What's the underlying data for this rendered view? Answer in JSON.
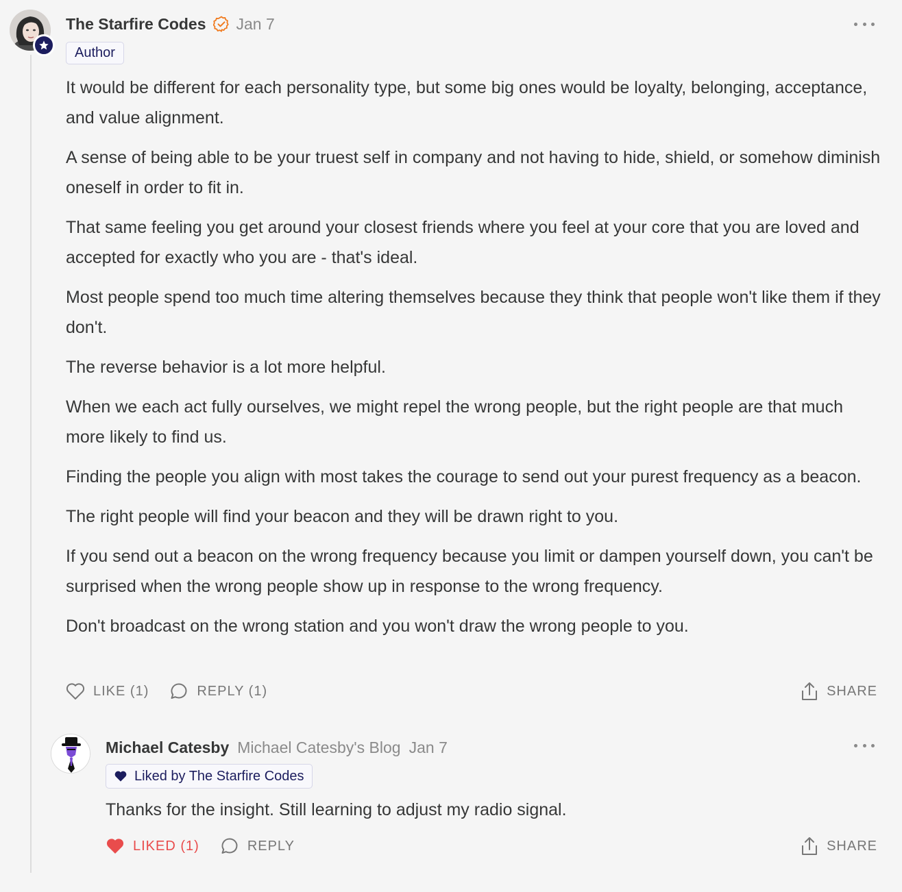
{
  "comment": {
    "author": "The Starfire Codes",
    "date": "Jan 7",
    "badge": "Author",
    "paragraphs": [
      "It would be different for each personality type, but some big ones would be loyalty, belonging, acceptance, and value alignment.",
      "A sense of being able to be your truest self in company and not having to hide, shield, or somehow diminish oneself in order to fit in.",
      "That same feeling you get around your closest friends where you feel at your core that you are loved and accepted for exactly who you are - that's ideal.",
      "Most people spend too much time altering themselves because they think that people won't like them if they don't.",
      "The reverse behavior is a lot more helpful.",
      "When we each act fully ourselves, we might repel the wrong people, but the right people are that much more likely to find us.",
      "Finding the people you align with most takes the courage to send out your purest frequency as a beacon.",
      "The right people will find your beacon and they will be drawn right to you.",
      "If you send out a beacon on the wrong frequency because you limit or dampen yourself down, you can't be surprised when the wrong people show up in response to the wrong frequency.",
      "Don't broadcast on the wrong station and you won't draw the wrong people to you."
    ],
    "like_label": "LIKE (1)",
    "reply_label": "REPLY (1)",
    "share_label": "SHARE"
  },
  "reply": {
    "author": "Michael Catesby",
    "blog": "Michael Catesby's Blog",
    "date": "Jan 7",
    "liked_by": "Liked by The Starfire Codes",
    "text": "Thanks for the insight. Still learning to adjust my radio signal.",
    "liked_label": "LIKED (1)",
    "reply_label": "REPLY",
    "share_label": "SHARE"
  },
  "colors": {
    "accent_navy": "#1c1d5e",
    "verified_orange": "#f07a1e",
    "liked_red": "#e94c4c",
    "muted_text": "#777777"
  },
  "icons": [
    "verified-check-icon",
    "star-badge-icon",
    "more-options-icon",
    "heart-outline-icon",
    "heart-filled-icon",
    "speech-bubble-icon",
    "share-upload-icon"
  ]
}
